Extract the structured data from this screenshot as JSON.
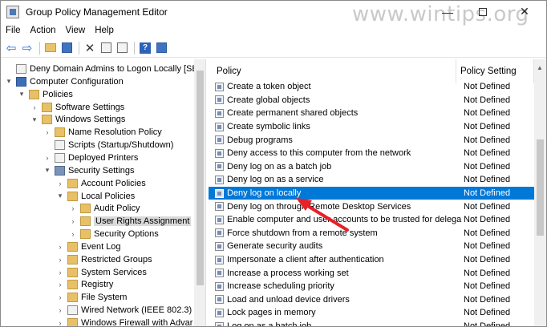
{
  "window": {
    "title": "Group Policy Management Editor"
  },
  "watermark": "www.wintips.org",
  "menu": [
    "File",
    "Action",
    "View",
    "Help"
  ],
  "toolbar_icons": [
    "back-icon",
    "forward-icon",
    "up-folder-icon",
    "show-tree-icon",
    "delete-icon",
    "properties-icon",
    "export-list-icon",
    "help-icon",
    "console-icon"
  ],
  "tree": [
    {
      "label": "Deny Domain Admins to Logon Locally [SERVEI",
      "depth": 0,
      "arrow": "",
      "icon": "doc"
    },
    {
      "label": "Computer Configuration",
      "depth": 0,
      "arrow": "▾",
      "icon": "pc"
    },
    {
      "label": "Policies",
      "depth": 1,
      "arrow": "▾",
      "icon": "folder"
    },
    {
      "label": "Software Settings",
      "depth": 2,
      "arrow": "›",
      "icon": "folder"
    },
    {
      "label": "Windows Settings",
      "depth": 2,
      "arrow": "▾",
      "icon": "folder"
    },
    {
      "label": "Name Resolution Policy",
      "depth": 3,
      "arrow": "›",
      "icon": "folder"
    },
    {
      "label": "Scripts (Startup/Shutdown)",
      "depth": 3,
      "arrow": "",
      "icon": "doc"
    },
    {
      "label": "Deployed Printers",
      "depth": 3,
      "arrow": "›",
      "icon": "doc"
    },
    {
      "label": "Security Settings",
      "depth": 3,
      "arrow": "▾",
      "icon": "shield"
    },
    {
      "label": "Account Policies",
      "depth": 4,
      "arrow": "›",
      "icon": "folder"
    },
    {
      "label": "Local Policies",
      "depth": 4,
      "arrow": "▾",
      "icon": "folder"
    },
    {
      "label": "Audit Policy",
      "depth": 5,
      "arrow": "›",
      "icon": "folder"
    },
    {
      "label": "User Rights Assignment",
      "depth": 5,
      "arrow": "›",
      "icon": "folder",
      "selected": true
    },
    {
      "label": "Security Options",
      "depth": 5,
      "arrow": "›",
      "icon": "folder"
    },
    {
      "label": "Event Log",
      "depth": 4,
      "arrow": "›",
      "icon": "folder"
    },
    {
      "label": "Restricted Groups",
      "depth": 4,
      "arrow": "›",
      "icon": "folder"
    },
    {
      "label": "System Services",
      "depth": 4,
      "arrow": "›",
      "icon": "folder"
    },
    {
      "label": "Registry",
      "depth": 4,
      "arrow": "›",
      "icon": "folder"
    },
    {
      "label": "File System",
      "depth": 4,
      "arrow": "›",
      "icon": "folder"
    },
    {
      "label": "Wired Network (IEEE 802.3) Po",
      "depth": 4,
      "arrow": "›",
      "icon": "doc"
    },
    {
      "label": "Windows Firewall with Advar",
      "depth": 4,
      "arrow": "›",
      "icon": "folder"
    }
  ],
  "columns": {
    "policy": "Policy",
    "setting": "Policy Setting"
  },
  "policies": [
    {
      "name": "Create a token object",
      "setting": "Not Defined"
    },
    {
      "name": "Create global objects",
      "setting": "Not Defined"
    },
    {
      "name": "Create permanent shared objects",
      "setting": "Not Defined"
    },
    {
      "name": "Create symbolic links",
      "setting": "Not Defined"
    },
    {
      "name": "Debug programs",
      "setting": "Not Defined"
    },
    {
      "name": "Deny access to this computer from the network",
      "setting": "Not Defined"
    },
    {
      "name": "Deny log on as a batch job",
      "setting": "Not Defined"
    },
    {
      "name": "Deny log on as a service",
      "setting": "Not Defined"
    },
    {
      "name": "Deny log on locally",
      "setting": "Not Defined",
      "selected": true
    },
    {
      "name": "Deny log on through Remote Desktop Services",
      "setting": "Not Defined"
    },
    {
      "name": "Enable computer and user accounts to be trusted for delega...",
      "setting": "Not Defined"
    },
    {
      "name": "Force shutdown from a remote system",
      "setting": "Not Defined"
    },
    {
      "name": "Generate security audits",
      "setting": "Not Defined"
    },
    {
      "name": "Impersonate a client after authentication",
      "setting": "Not Defined"
    },
    {
      "name": "Increase a process working set",
      "setting": "Not Defined"
    },
    {
      "name": "Increase scheduling priority",
      "setting": "Not Defined"
    },
    {
      "name": "Load and unload device drivers",
      "setting": "Not Defined"
    },
    {
      "name": "Lock pages in memory",
      "setting": "Not Defined"
    },
    {
      "name": "Log on as a batch job",
      "setting": "Not Defined"
    }
  ],
  "colors": {
    "selection": "#0078d7",
    "arrow": "#e8202a"
  }
}
